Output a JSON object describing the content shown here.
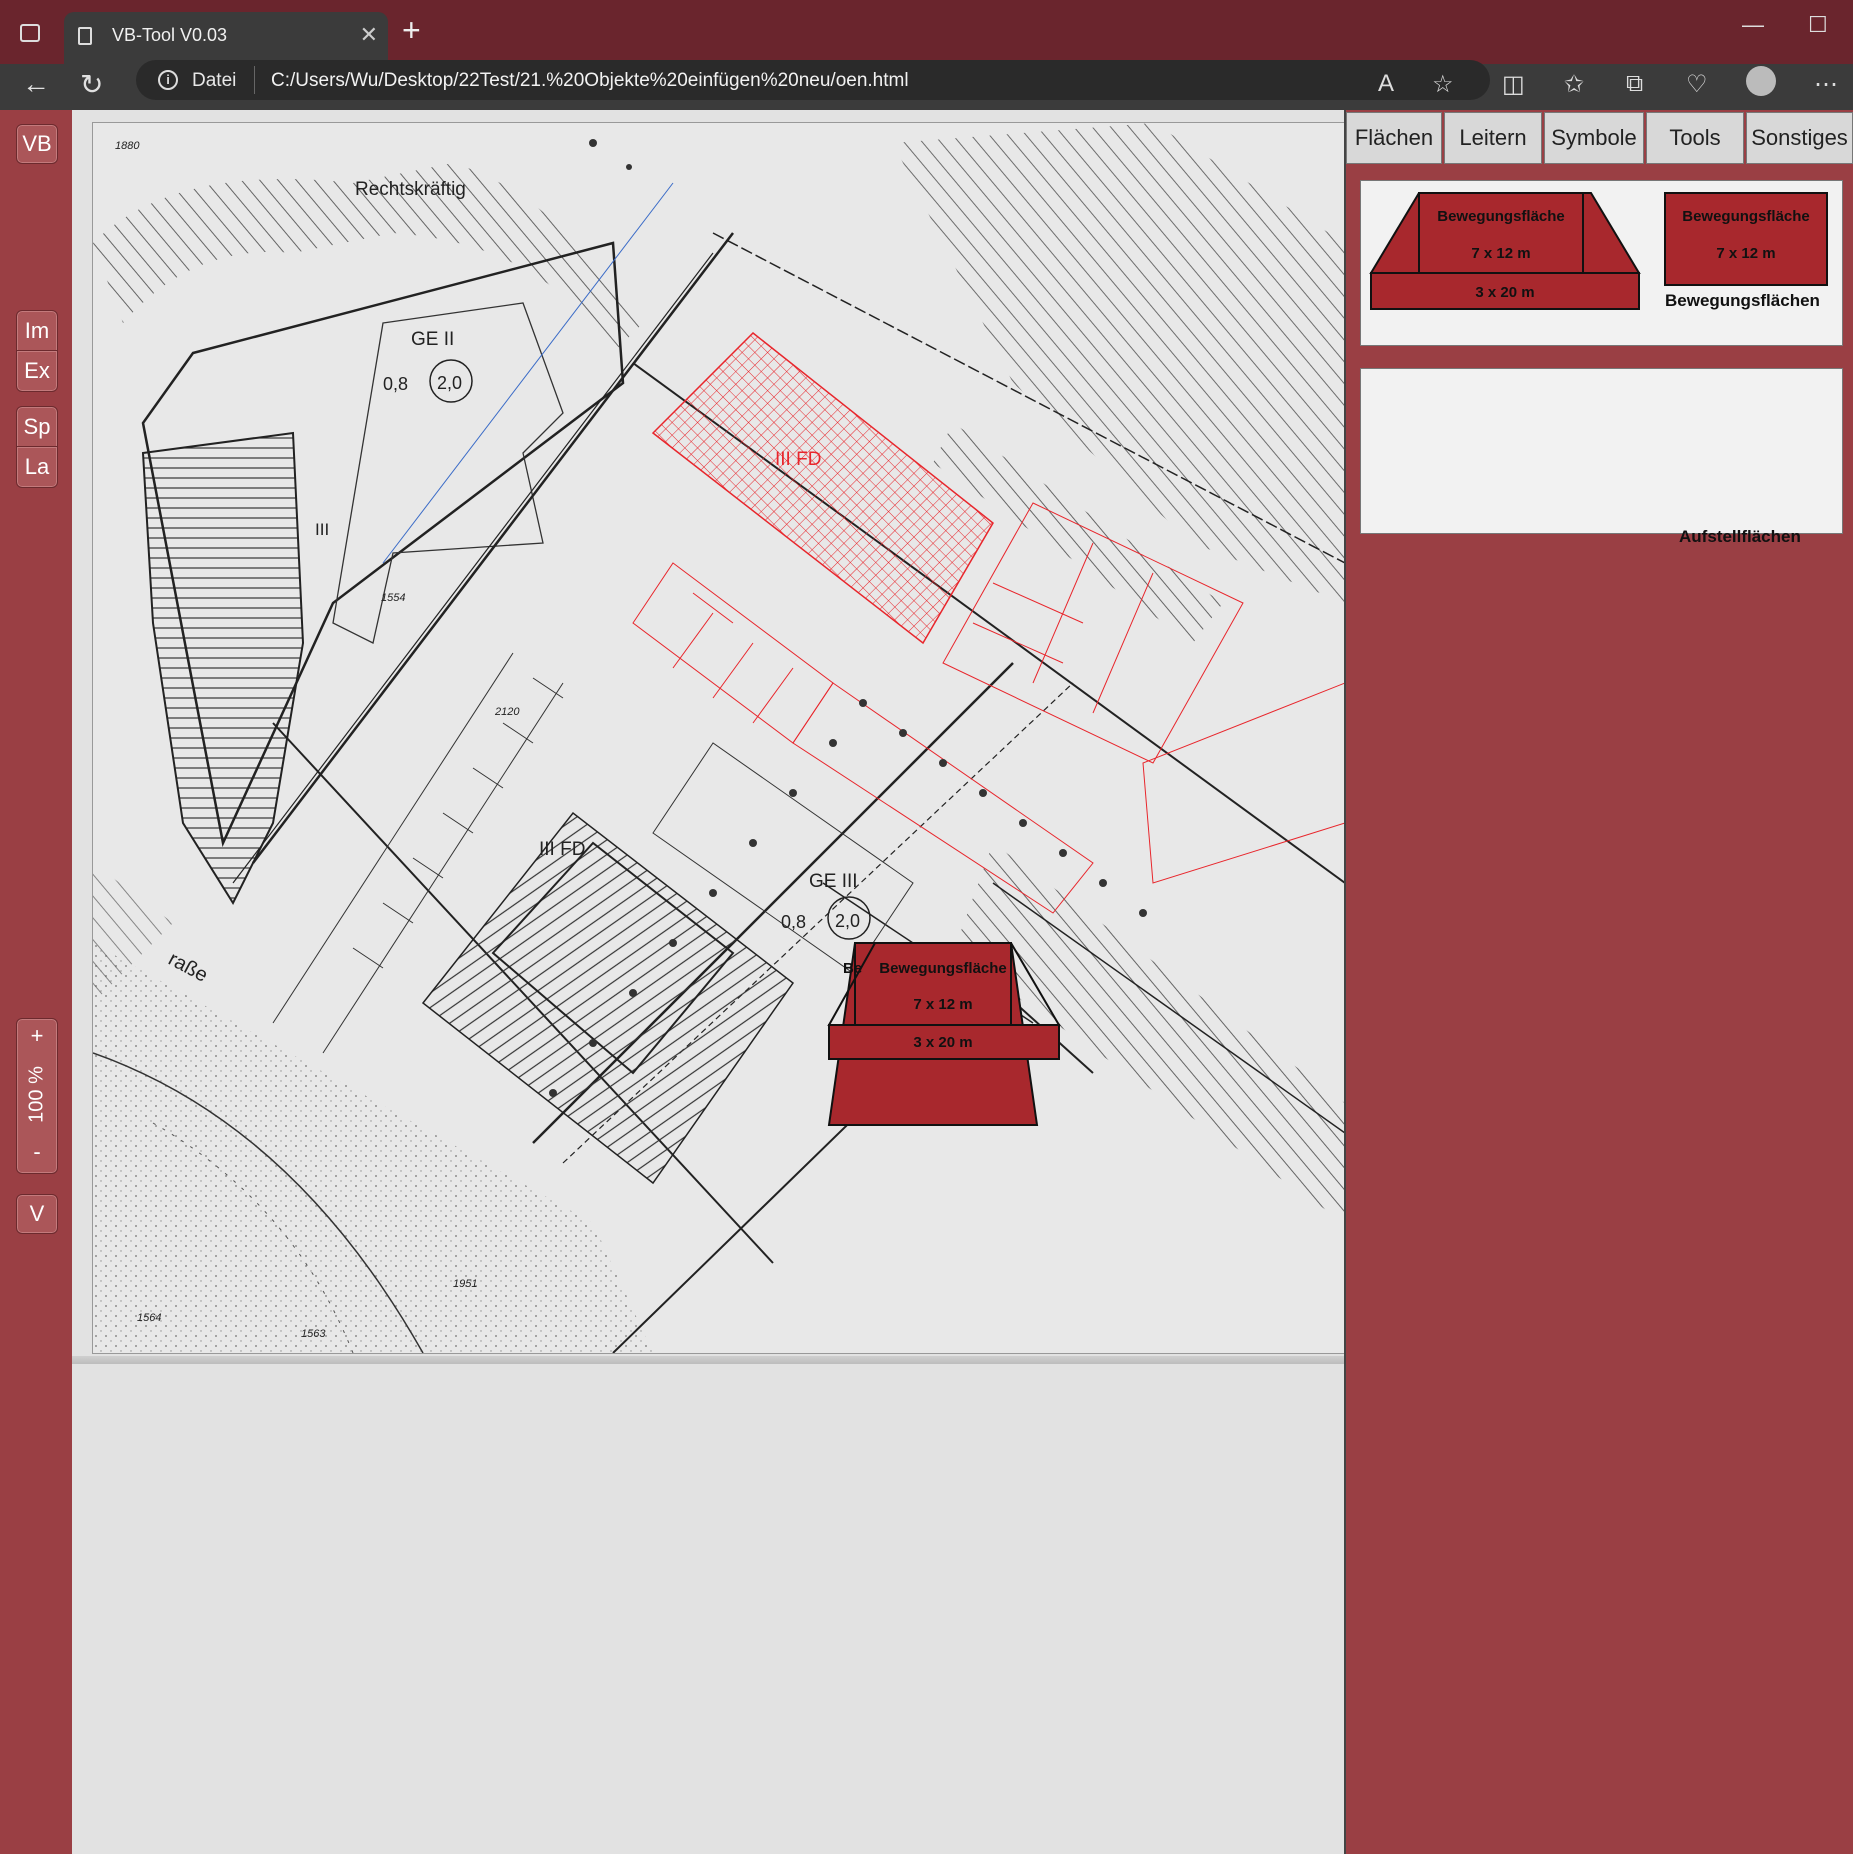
{
  "browser": {
    "tab_title": "VB-Tool V0.03",
    "tab_close": "✕",
    "new_tab": "+",
    "minimize": "—",
    "maximize": "☐",
    "url_scheme_label": "Datei",
    "url": "C:/Users/Wu/Desktop/22Test/21.%20Objekte%20einfügen%20neu/oen.html"
  },
  "left_toolbar": {
    "buttons": [
      "VB",
      "Im",
      "Ex",
      "Sp",
      "La"
    ],
    "zoom_in": "+",
    "zoom_level": "100 %",
    "zoom_out": "-",
    "v_button": "V"
  },
  "map": {
    "labels": {
      "year": "1880",
      "rechtskraeftig": "Rechtskräftig",
      "ge_ii": "GE   II",
      "grz_1": "0,8",
      "gfz_1": "2,0",
      "iii_a": "III",
      "iii_fd_red": "III FD",
      "iii_fd": "III FD",
      "ge_iii": "GE   III",
      "grz_2": "0,8",
      "gfz_2": "2,0",
      "lot_1554": "1554",
      "lot_2120": "2120",
      "lot_1951": "1951",
      "lot_1564": "1564",
      "lot_1563": "1563",
      "strasse": "raße"
    },
    "placed_object": {
      "partial": "Be",
      "main": "Bewegungsfläche",
      "dim1": "7 x 12 m",
      "dim2": "3 x 20 m"
    }
  },
  "panel": {
    "tabs": [
      "Flächen",
      "Leitern",
      "Symbole",
      "Tools",
      "Sonstiges"
    ],
    "shape_a": {
      "title": "Bewegungsfläche",
      "dim1": "7 x 12 m",
      "dim2": "3 x 20 m"
    },
    "shape_b": {
      "title": "Bewegungsfläche",
      "dim1": "7 x 12 m"
    },
    "group1_caption": "Bewegungsflächen",
    "group2_caption": "Aufstellflächen"
  },
  "colors": {
    "window_frame": "#6a252d",
    "panel_bg": "#9a3f44",
    "shape_fill": "#a8282d",
    "plan_red": "#e8262c"
  }
}
